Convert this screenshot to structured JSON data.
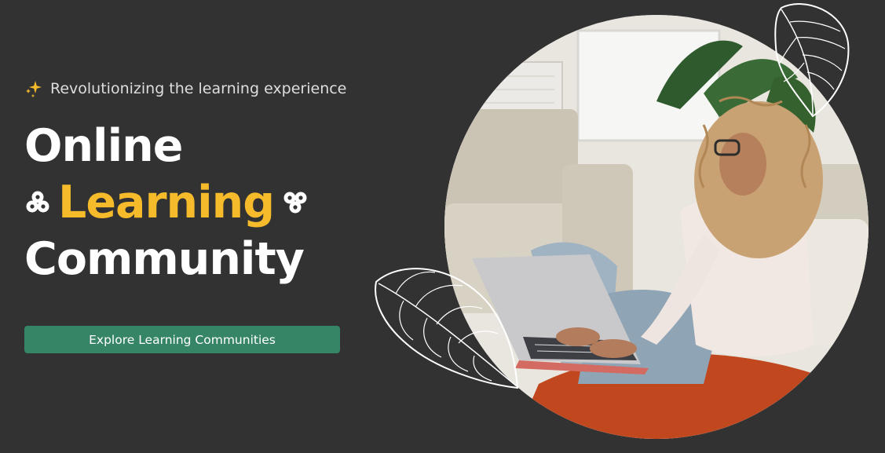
{
  "hero": {
    "tagline": "Revolutionizing the learning experience",
    "headline_line1": "Online",
    "headline_highlight": "Learning",
    "headline_line3": "Community",
    "cta_label": "Explore Learning Communities"
  },
  "colors": {
    "background": "#323232",
    "accent_yellow": "#f6bb2b",
    "cta_green": "#358566",
    "text_white": "#ffffff"
  },
  "icons": {
    "tagline_icon": "sparkle-icon",
    "headline_left_icon": "flower-blob-icon",
    "headline_right_icon": "flower-blob-icon",
    "decoration": "leaf-outline-icon"
  },
  "image": {
    "subject": "woman with curly hair using a laptop on the floor"
  }
}
